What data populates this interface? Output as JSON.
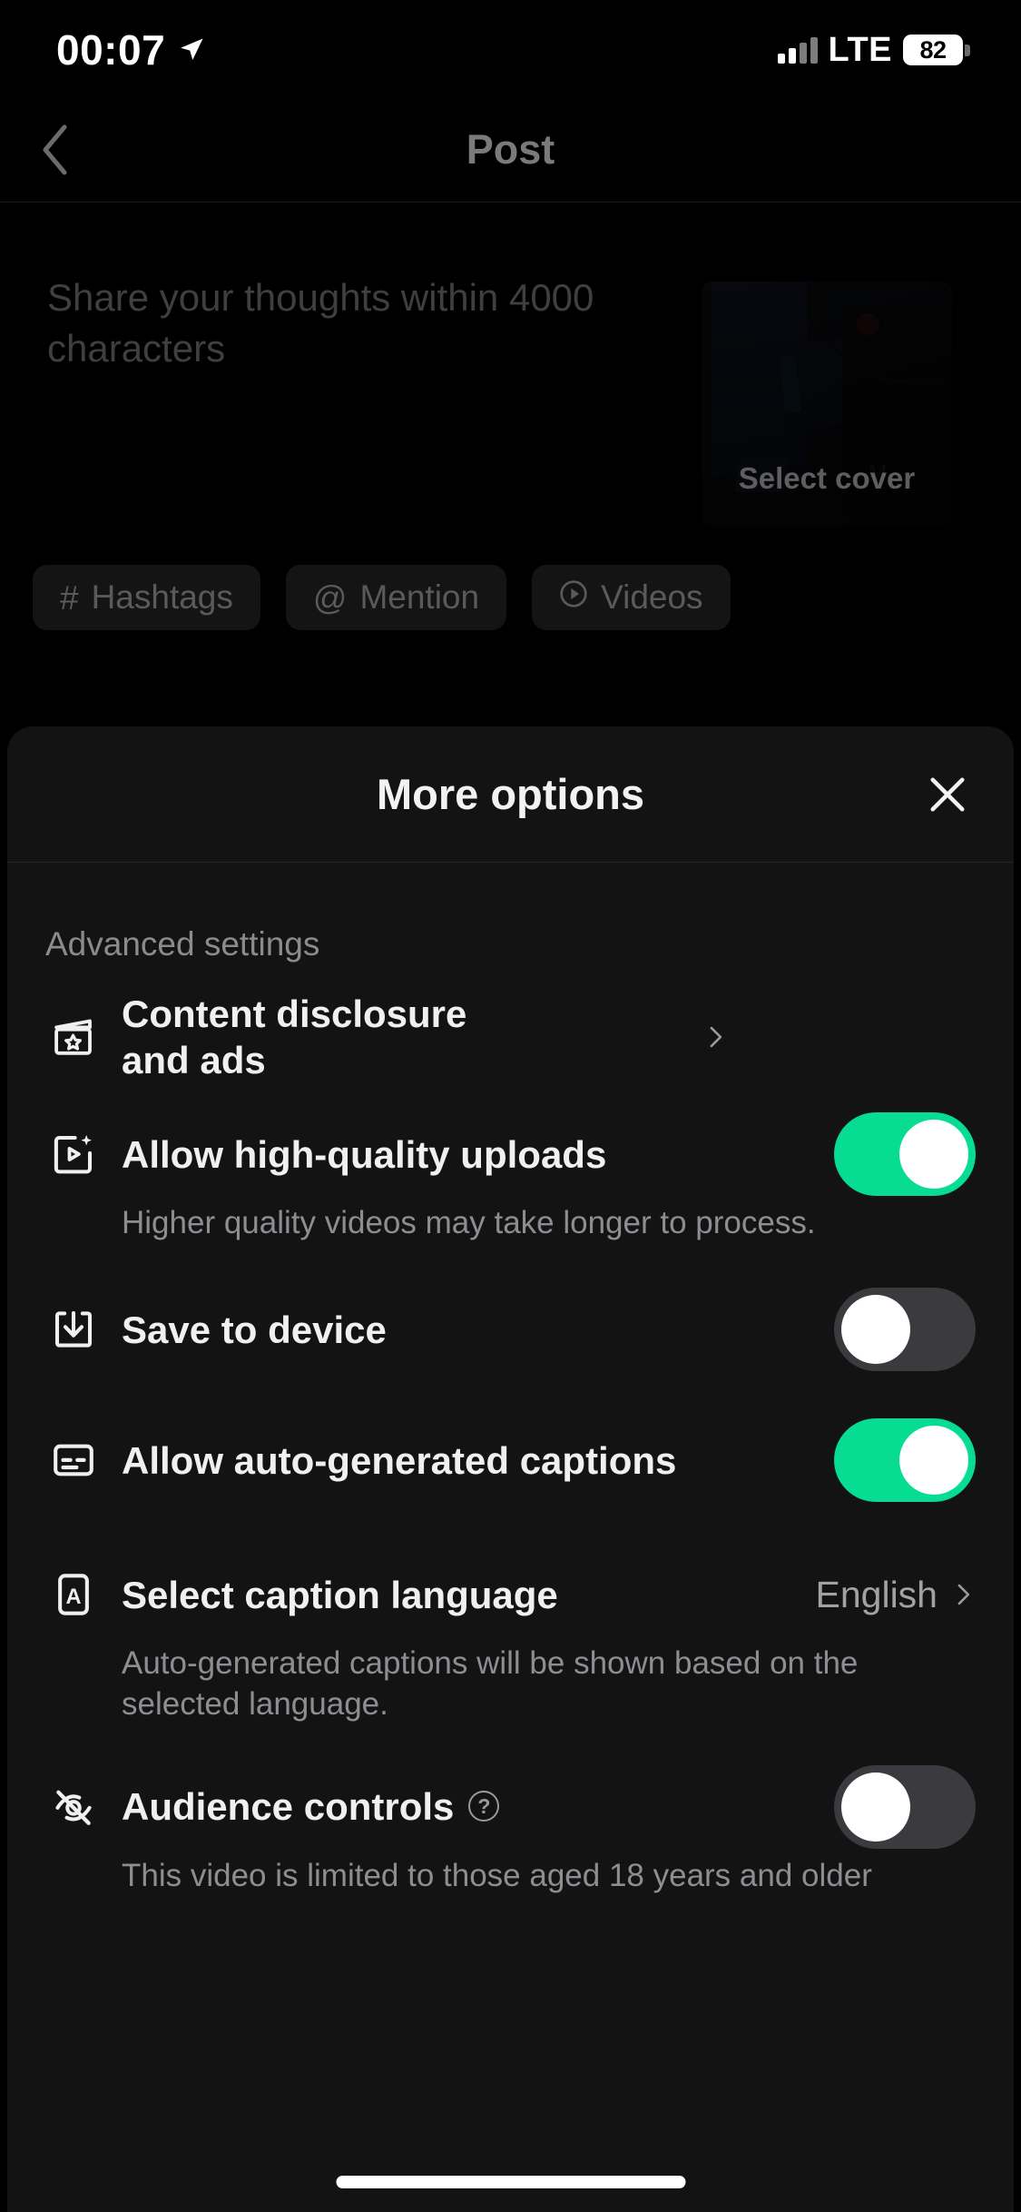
{
  "status_bar": {
    "time": "00:07",
    "location_icon": "location-arrow-icon",
    "network_label": "LTE",
    "battery_level": "82",
    "signal_icon": "cellular-signal-icon"
  },
  "nav": {
    "back_icon": "chevron-left-icon",
    "title": "Post"
  },
  "composer": {
    "placeholder": "Share your thoughts within 4000 characters",
    "select_cover_label": "Select cover",
    "chips": [
      {
        "icon": "hash-icon",
        "glyph": "#",
        "label": "Hashtags"
      },
      {
        "icon": "at-icon",
        "glyph": "@",
        "label": "Mention"
      },
      {
        "icon": "play-circle-icon",
        "glyph": "",
        "label": "Videos"
      }
    ]
  },
  "sheet": {
    "title": "More options",
    "close_icon": "close-icon",
    "section_label": "Advanced settings",
    "items": [
      {
        "key": "content_disclosure",
        "icon": "content-disclosure-icon",
        "label": "Content disclosure\nand ads",
        "label_line1": "Content disclosure",
        "label_line2": "and ads",
        "control": "chevron",
        "chevron_icon": "chevron-right-icon"
      },
      {
        "key": "high_quality_uploads",
        "icon": "hq-video-icon",
        "label": "Allow high-quality uploads",
        "control": "toggle",
        "toggle_state": "on",
        "subtitle": "Higher quality videos may take longer to process."
      },
      {
        "key": "save_to_device",
        "icon": "download-icon",
        "label": "Save to device",
        "control": "toggle",
        "toggle_state": "off",
        "subtitle": ""
      },
      {
        "key": "auto_captions",
        "icon": "captions-icon",
        "label": "Allow auto-generated captions",
        "control": "toggle",
        "toggle_state": "on",
        "subtitle": ""
      },
      {
        "key": "caption_language",
        "icon": "letter-a-box-icon",
        "label": "Select caption language",
        "control": "value-chevron",
        "value": "English",
        "chevron_icon": "chevron-right-icon",
        "subtitle": "Auto-generated captions will be shown based on the selected language."
      },
      {
        "key": "audience_controls",
        "icon": "eye-off-icon",
        "label": "Audience controls",
        "help_icon": "question-mark-icon",
        "help_glyph": "?",
        "control": "toggle",
        "toggle_state": "off",
        "subtitle": "This video is limited to those aged 18 years and older"
      }
    ]
  },
  "colors": {
    "toggle_on": "#06dc92",
    "toggle_off": "#3a3a3f",
    "sheet_bg": "#131314",
    "page_bg": "#000000",
    "primary_text": "#f0f0f0",
    "secondary_text": "#8e8e92"
  }
}
